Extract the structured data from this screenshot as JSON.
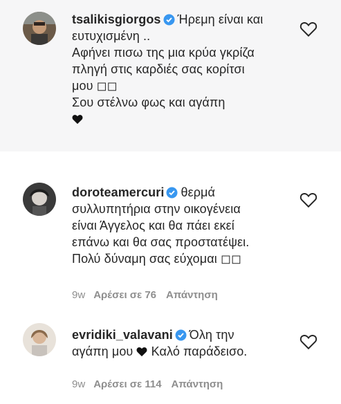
{
  "comments": [
    {
      "username": "tsalikisgiorgos",
      "lines": [
        "Ήρεμη είναι και",
        "ευτυχισμένη ..",
        "Αφήνει πισω της μια κρύα γκρίζα",
        "πληγή στις καρδιές σας κορίτσι",
        "μου ◻◻",
        "Σου στέλνω φως και αγάπη"
      ],
      "trailing_icon": "black-heart-emoji",
      "like_icon": "heart-outline-icon"
    },
    {
      "username": "doroteamercuri",
      "lines": [
        "θερμά",
        "συλλυπητήρια στην οικογένεια",
        "είναι Άγγελος και θα πάει εκεί",
        "επάνω και θα σας προστατέψει.",
        "Πολύ δύναμη σας εύχομαι ◻◻"
      ],
      "time": "9w",
      "likes": "Αρέσει σε 76",
      "reply": "Απάντηση",
      "like_icon": "heart-outline-icon"
    },
    {
      "username": "evridiki_valavani",
      "lines": [
        "Όλη την",
        "αγάπη μου",
        "Καλό παράδεισο."
      ],
      "time": "9w",
      "likes": "Αρέσει σε 114",
      "reply": "Απάντηση",
      "like_icon": "heart-outline-icon"
    }
  ],
  "colors": {
    "verified": "#3897f0",
    "text": "#262626",
    "meta": "#8e8e8e",
    "highlight_bg": "#f6f6f7"
  }
}
